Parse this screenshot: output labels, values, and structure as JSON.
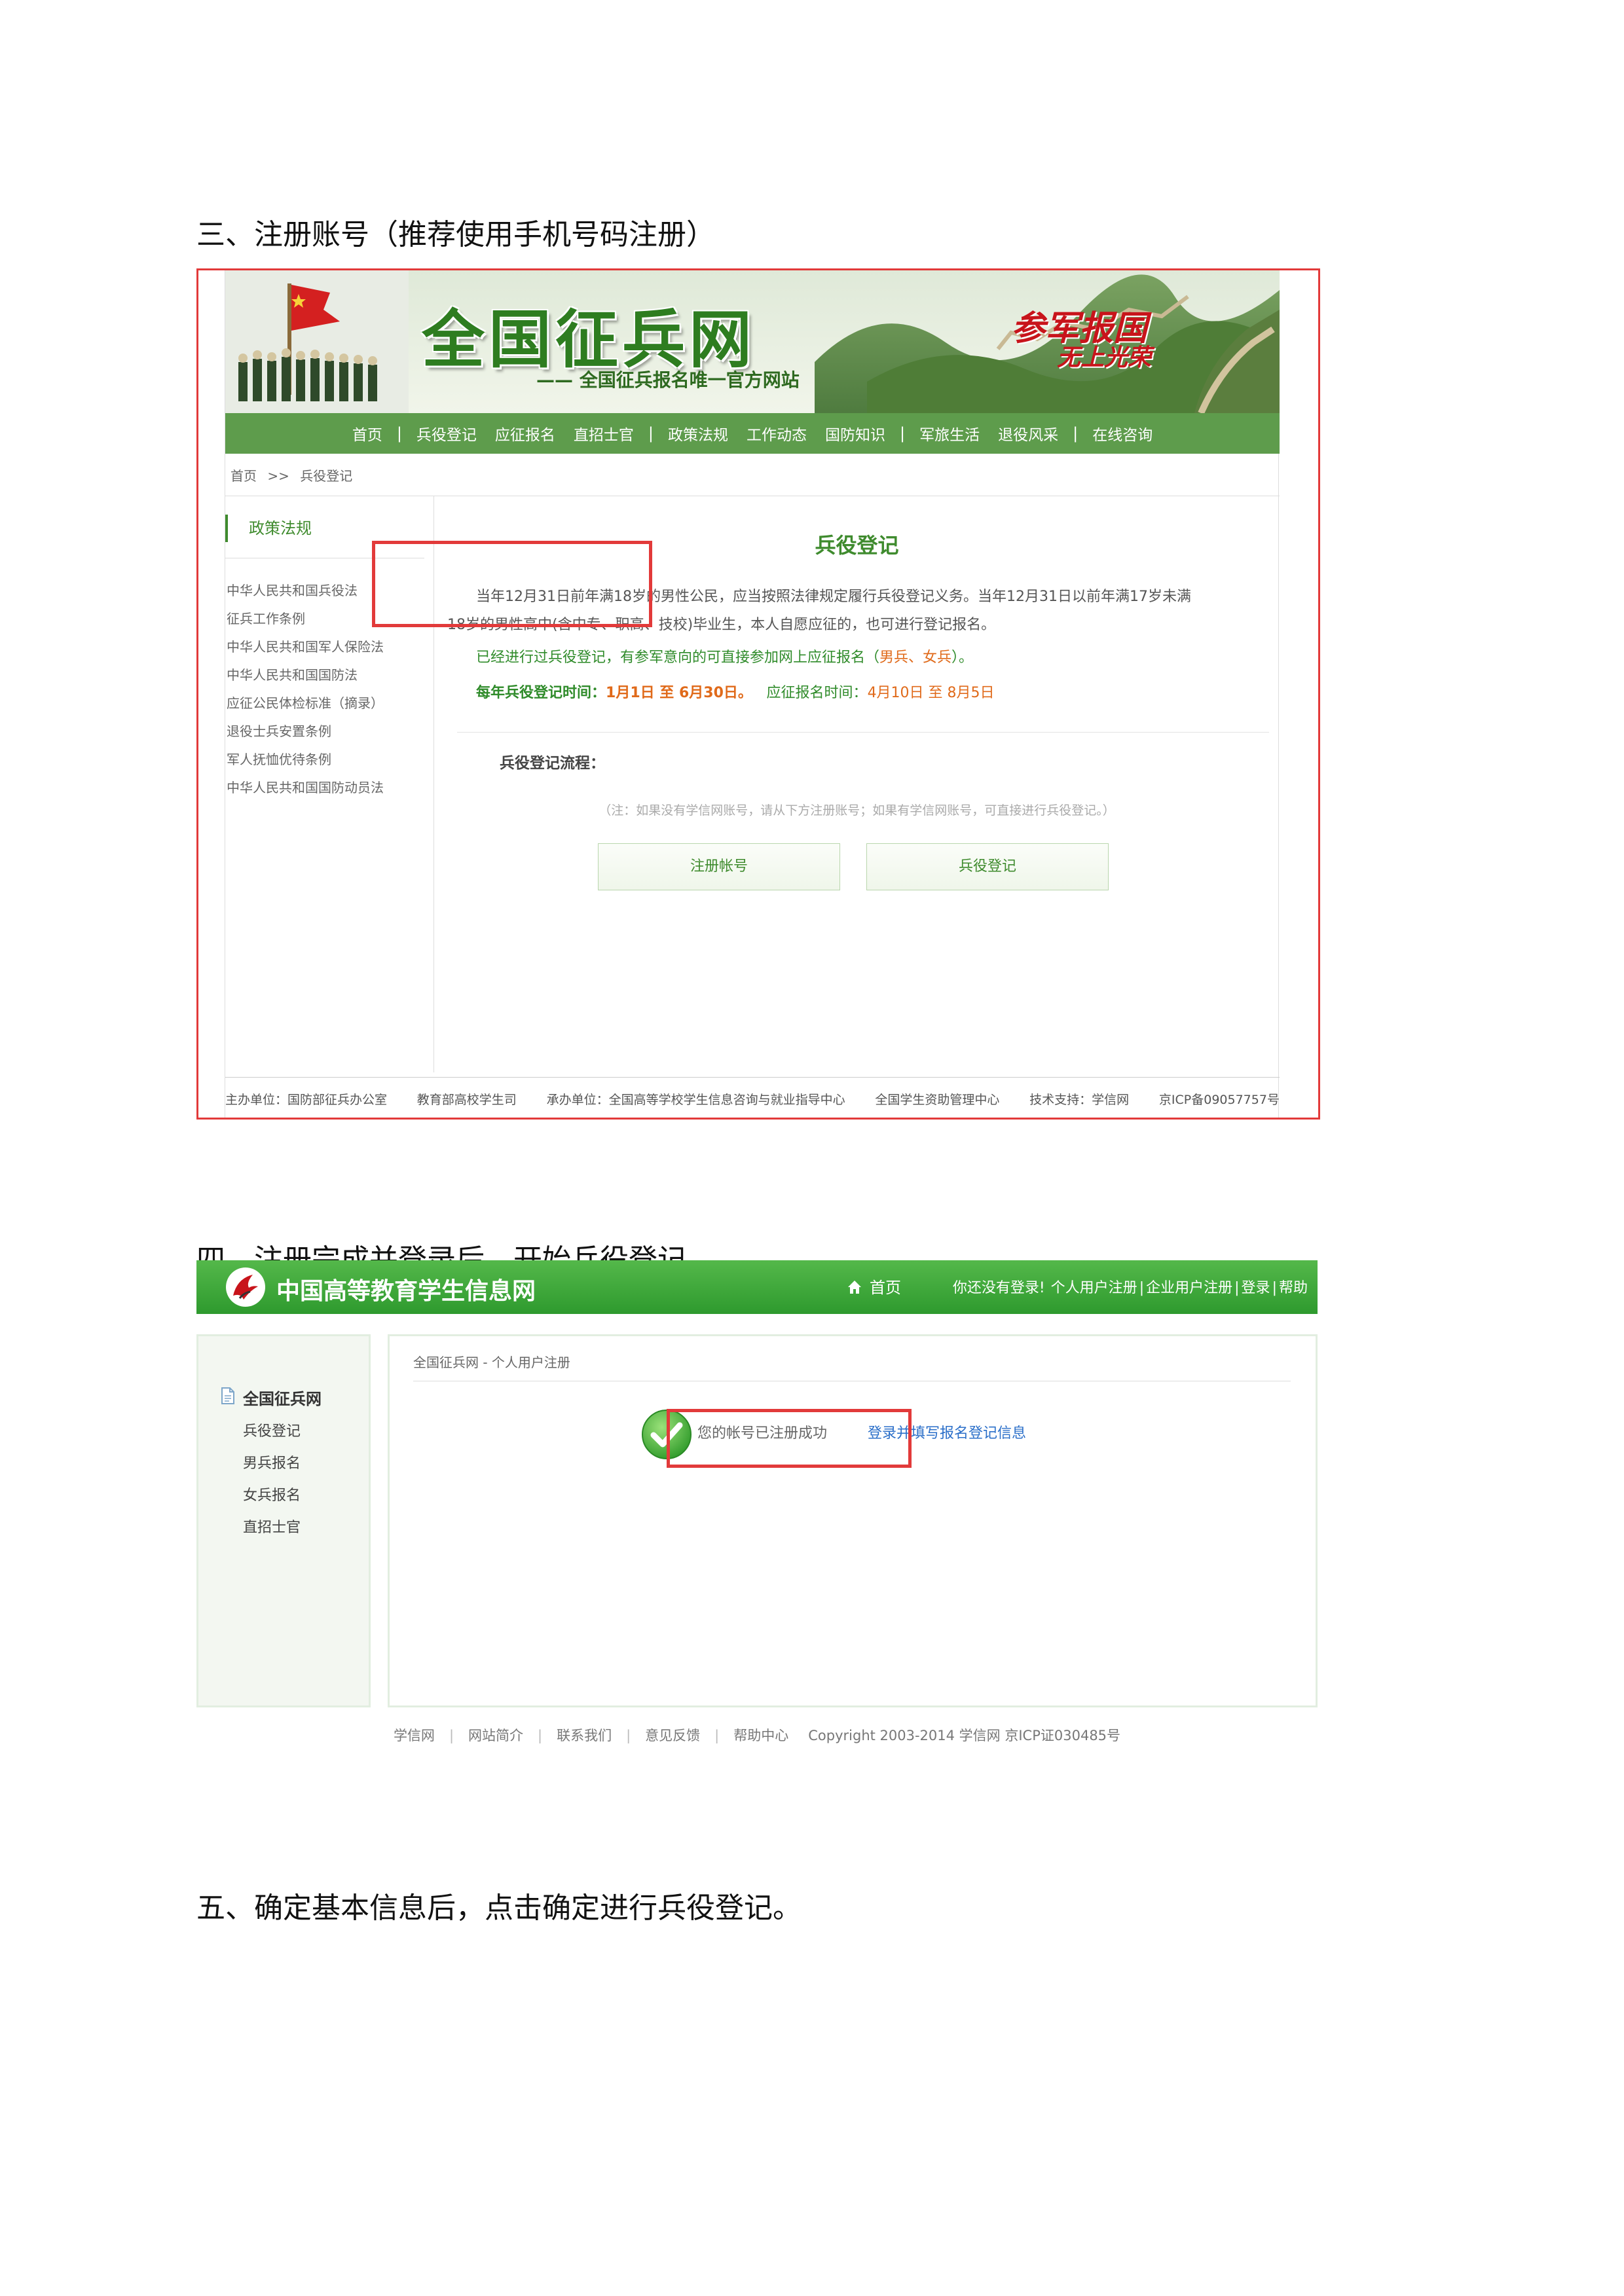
{
  "steps": {
    "step3": "三、注册账号（推荐使用手机号码注册）",
    "step4": "四、注册完成并登录后，开始兵役登记。",
    "step5": "五、确定基本信息后，点击确定进行兵役登记。"
  },
  "site1": {
    "logo": "全国征兵网",
    "slogan": "—— 全国征兵报名唯一官方网站",
    "motto_line1": "参军报国",
    "motto_line2": "无上光荣",
    "nav": [
      "首页",
      "兵役登记",
      "应征报名",
      "直招士官",
      "政策法规",
      "工作动态",
      "国防知识",
      "军旅生活",
      "退役风采",
      "在线咨询"
    ],
    "breadcrumb": [
      "首页",
      ">>",
      "兵役登记"
    ],
    "sidebar": {
      "title": "政策法规",
      "links": [
        "中华人民共和国兵役法",
        "征兵工作条例",
        "中华人民共和国军人保险法",
        "中华人民共和国国防法",
        "应征公民体检标准（摘录）",
        "退役士兵安置条例",
        "军人抚恤优待条例",
        "中华人民共和国国防动员法"
      ]
    },
    "content": {
      "title": "兵役登记",
      "para1_line1": "当年12月31日前年满18岁的男性公民，应当按照法律规定履行兵役登记义务。当年12月31日以前年满17岁未满",
      "para1_line2": "18岁的男性高中(含中专、职高、技校)毕业生，本人自愿应征的，也可进行登记报名。",
      "para2_text": "已经进行过兵役登记，有参军意向的可直接参加网上应征报名（",
      "para2_highlight": "男兵、女兵",
      "para2_end": "）。",
      "time_label": "每年兵役登记时间：",
      "time_value": "1月1日 至 6月30日。",
      "enlist_label": "应征报名时间：",
      "enlist_value": "4月10日 至 8月5日",
      "flow_label": "兵役登记流程：",
      "note": "（注：如果没有学信网账号，请从下方注册账号；如果有学信网账号，可直接进行兵役登记。）",
      "btn_register": "注册帐号",
      "btn_bingyi": "兵役登记"
    },
    "footer": [
      "主办单位：国防部征兵办公室",
      "教育部高校学生司",
      "承办单位：全国高等学校学生信息咨询与就业指导中心",
      "全国学生资助管理中心",
      "技术支持：学信网",
      "京ICP备09057757号"
    ]
  },
  "site2": {
    "name": "中国高等教育学生信息网",
    "home": "首页",
    "toplinks": [
      "你还没有登录!",
      "个人用户注册",
      "企业用户注册",
      "登录",
      "帮助"
    ],
    "sidebar_title": "全国征兵网",
    "sidebar_links": [
      "兵役登记",
      "男兵报名",
      "女兵报名",
      "直招士官"
    ],
    "breadcrumb": "全国征兵网 - 个人用户注册",
    "success": "您的帐号已注册成功",
    "login_link": "登录并填写报名登记信息",
    "footer_links": [
      "学信网",
      "网站简介",
      "联系我们",
      "意见反馈",
      "帮助中心"
    ],
    "copyright": "Copyright 2003-2014 学信网 京ICP证030485号"
  },
  "colors": {
    "green": "#3f8b2e",
    "nav_green": "#5e9c4c",
    "highlight_red": "#e23a3a",
    "orange": "#e06a1a",
    "link_blue": "#2b6fc9"
  }
}
